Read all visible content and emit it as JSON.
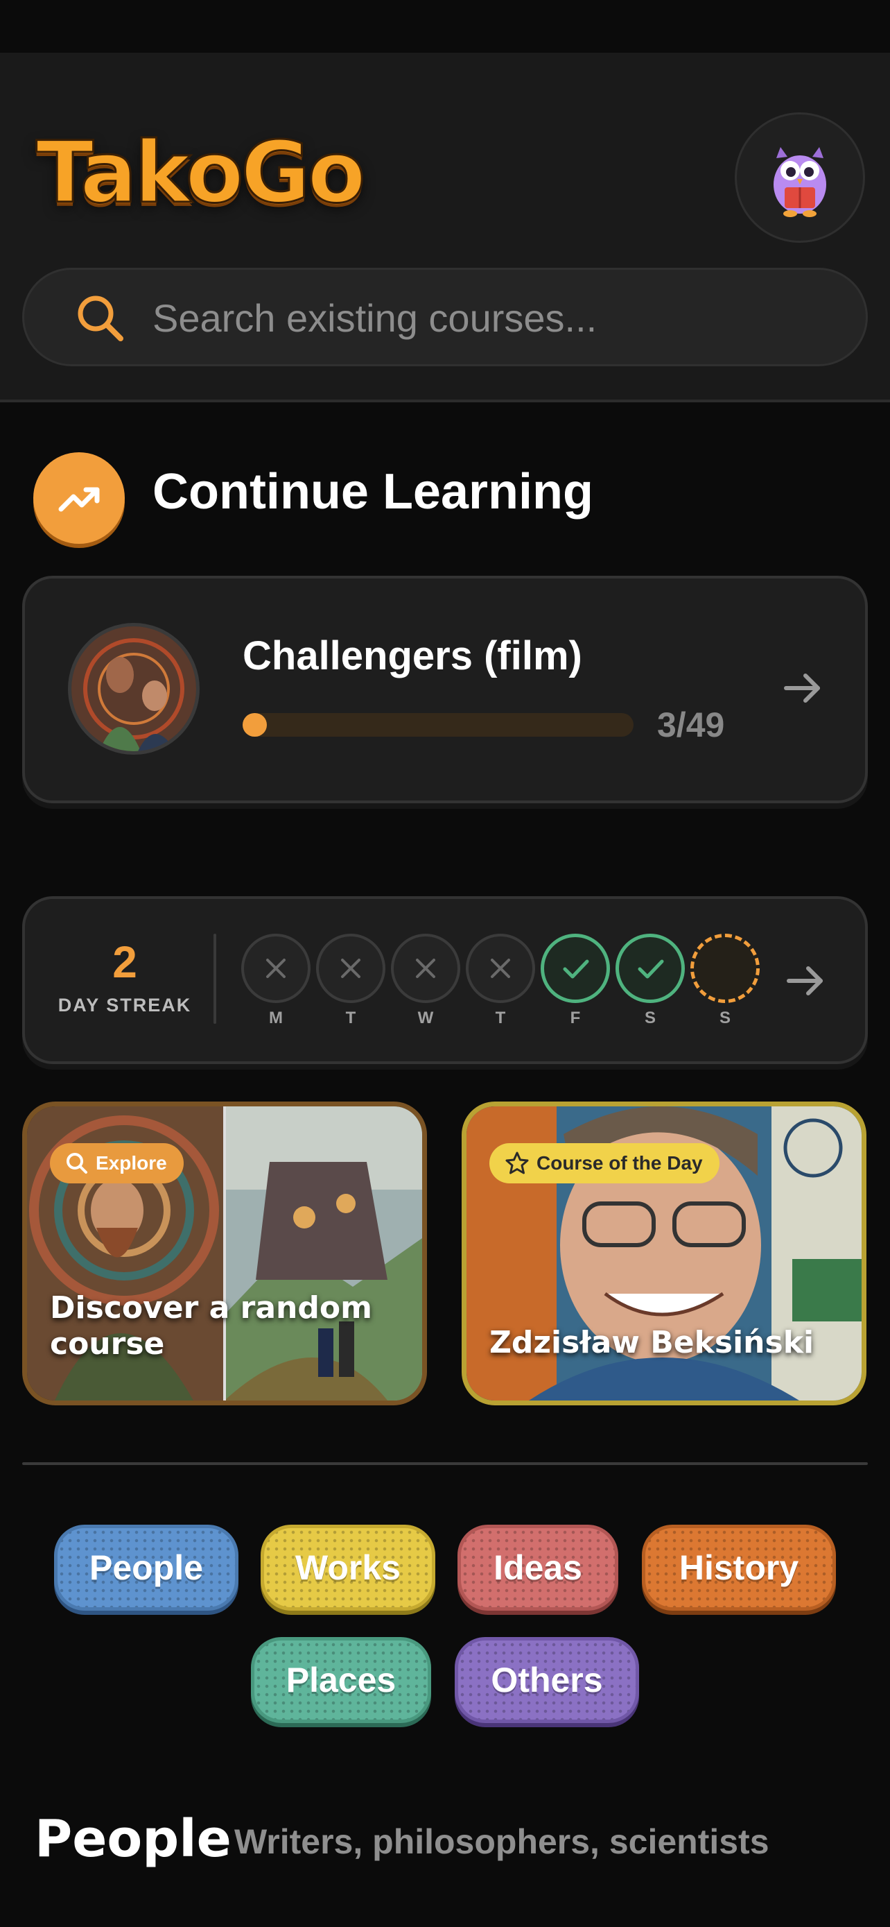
{
  "app": {
    "logo_text": "TakoGo"
  },
  "search": {
    "placeholder": "Search existing courses..."
  },
  "continue_learning": {
    "title": "Continue Learning",
    "course": {
      "title": "Challengers (film)",
      "progress_text": "3/49",
      "progress_current": 3,
      "progress_total": 49
    }
  },
  "streak": {
    "count": "2",
    "label": "DAY STREAK",
    "days": [
      {
        "letter": "M",
        "status": "missed"
      },
      {
        "letter": "T",
        "status": "missed"
      },
      {
        "letter": "W",
        "status": "missed"
      },
      {
        "letter": "T",
        "status": "missed"
      },
      {
        "letter": "F",
        "status": "done"
      },
      {
        "letter": "S",
        "status": "done"
      },
      {
        "letter": "S",
        "status": "today"
      }
    ]
  },
  "feature_cards": {
    "explore": {
      "badge": "Explore",
      "text_line1": "Discover a random",
      "text_line2": "course"
    },
    "course_of_day": {
      "badge": "Course of the Day",
      "text": "Zdzisław Beksiński"
    }
  },
  "categories": {
    "people": "People",
    "works": "Works",
    "ideas": "Ideas",
    "history": "History",
    "places": "Places",
    "others": "Others"
  },
  "section": {
    "title": "People",
    "subtitle": "Writers, philosophers, scientists"
  },
  "colors": {
    "accent_orange": "#f29e3c",
    "success_green": "#4fb37f",
    "background": "#0b0b0b",
    "card": "#1e1e1e"
  }
}
